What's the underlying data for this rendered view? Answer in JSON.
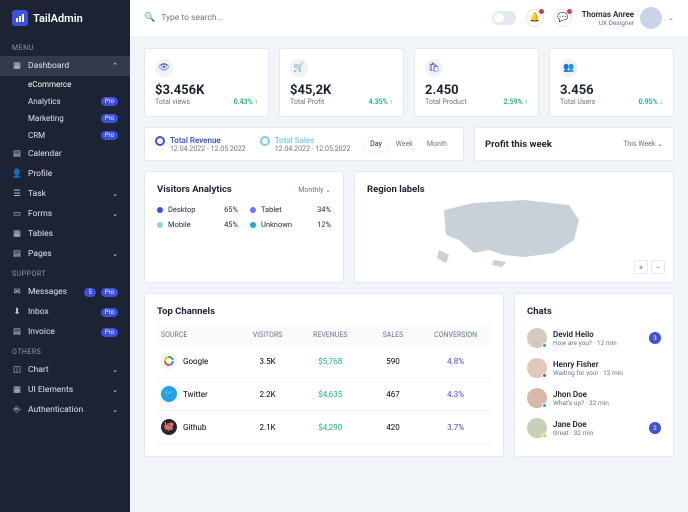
{
  "brand": "TailAdmin",
  "search": {
    "placeholder": "Type to search..."
  },
  "user": {
    "name": "Thomas Anree",
    "role": "UX Designer"
  },
  "nav": {
    "menu_label": "MENU",
    "support_label": "SUPPORT",
    "others_label": "OTHERS",
    "dashboard": "Dashboard",
    "subs": {
      "ecommerce": "eCommerce",
      "analytics": "Analytics",
      "marketing": "Marketing",
      "crm": "CRM"
    },
    "calendar": "Calendar",
    "profile": "Profile",
    "task": "Task",
    "forms": "Forms",
    "tables": "Tables",
    "pages": "Pages",
    "messages": "Messages",
    "messages_count": "5",
    "inbox": "Inbox",
    "invoice": "Invoice",
    "chart": "Chart",
    "ui": "UI Elements",
    "auth": "Authentication",
    "pro": "Pro"
  },
  "kpi": [
    {
      "value": "$3.456K",
      "label": "Total views",
      "change": "0.43%"
    },
    {
      "value": "$45,2K",
      "label": "Total Profit",
      "change": "4.35%"
    },
    {
      "value": "2.450",
      "label": "Total Product",
      "change": "2.59%"
    },
    {
      "value": "3.456",
      "label": "Total Users",
      "change": "0.95%"
    }
  ],
  "legend": {
    "a_title": "Total Revenue",
    "a_date": "12.04.2022 - 12.05.2022",
    "b_title": "Total Sales",
    "b_date": "12.04.2022 - 12.05.2022",
    "tabs": {
      "day": "Day",
      "week": "Week",
      "month": "Month"
    }
  },
  "profit": {
    "title": "Profit this week",
    "select": "This Week"
  },
  "analytics": {
    "title": "Visitors Analytics",
    "select": "Monthly",
    "items": [
      {
        "label": "Desktop",
        "val": "65%",
        "color": "#3c50e0"
      },
      {
        "label": "Tablet",
        "val": "34%",
        "color": "#6577f3"
      },
      {
        "label": "Mobile",
        "val": "45%",
        "color": "#8fd0ef"
      },
      {
        "label": "Unknown",
        "val": "12%",
        "color": "#0fadcf"
      }
    ]
  },
  "region": {
    "title": "Region labels"
  },
  "channels": {
    "title": "Top Channels",
    "headers": {
      "source": "SOURCE",
      "visitors": "VISITORS",
      "revenues": "REVENUES",
      "sales": "SALES",
      "conversion": "CONVERSION"
    },
    "rows": [
      {
        "name": "Google",
        "visitors": "3.5K",
        "rev": "$5,768",
        "sales": "590",
        "conv": "4.8%"
      },
      {
        "name": "Twitter",
        "visitors": "2.2K",
        "rev": "$4,635",
        "sales": "467",
        "conv": "4.3%"
      },
      {
        "name": "Github",
        "visitors": "2.1K",
        "rev": "$4,290",
        "sales": "420",
        "conv": "3.7%"
      }
    ]
  },
  "chats": {
    "title": "Chats",
    "items": [
      {
        "name": "Devid Heilo",
        "msg": "How are you?",
        "time": "12 min",
        "badge": "3"
      },
      {
        "name": "Henry Fisher",
        "msg": "Waiting for you!",
        "time": "12 min"
      },
      {
        "name": "Jhon Doe",
        "msg": "What's up?",
        "time": "32 min"
      },
      {
        "name": "Jane Doe",
        "msg": "Great",
        "time": "32 min",
        "badge": "2"
      }
    ]
  }
}
